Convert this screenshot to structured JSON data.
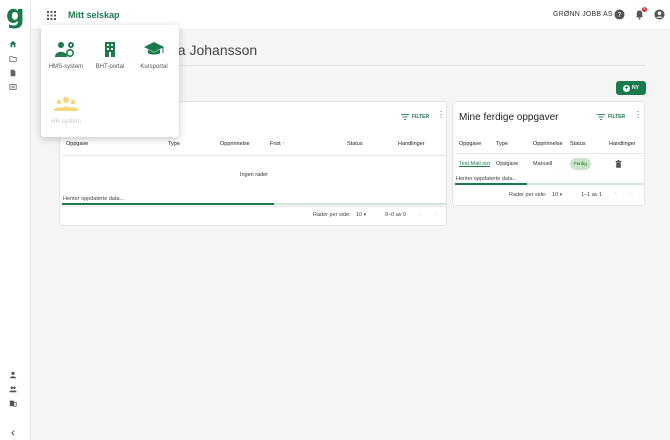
{
  "app": {
    "brand": "Mitt selskap",
    "company": "GRØNN JOBB AS",
    "notification_count": "5"
  },
  "page": {
    "title_fragment": "ea Johansson",
    "new_button": "NY"
  },
  "app_menu": {
    "items": [
      {
        "label": "HMS-system",
        "icon": "people-gear-icon",
        "enabled": true
      },
      {
        "label": "BHT-portal",
        "icon": "building-icon",
        "enabled": true
      },
      {
        "label": "Kursportal",
        "icon": "graduation-cap-icon",
        "enabled": true
      },
      {
        "label": "HR-system",
        "icon": "group-icon",
        "enabled": false
      }
    ]
  },
  "tasks_card": {
    "filter_label": "FILTER",
    "columns": [
      "Oppgave",
      "Type",
      "Opprinnelse",
      "Frist",
      "Status",
      "Handlinger"
    ],
    "empty_text": "Ingen rader",
    "loading_text": "Henter oppdaterte data...",
    "progress": 0.55,
    "rows_per_page_label": "Rader per side:",
    "rows_per_page": "10",
    "range": "0–0 av 0"
  },
  "done_card": {
    "title": "Mine ferdige oppgaver",
    "filter_label": "FILTER",
    "columns": [
      "Oppgave",
      "Type",
      "Opprinnelse",
      "Status",
      "Handlinger"
    ],
    "rows": [
      {
        "task": "Test Mail not",
        "type": "Oppgave",
        "origin": "Manuell",
        "status": "Ferdig"
      }
    ],
    "loading_text": "Henter oppdaterte data...",
    "progress": 0.38,
    "rows_per_page_label": "Rader per side:",
    "rows_per_page": "10",
    "range": "1–1 av 1"
  },
  "colors": {
    "brand": "#1b7a4c",
    "badge": "#d32f2f",
    "chip": "#c8e6c9"
  }
}
